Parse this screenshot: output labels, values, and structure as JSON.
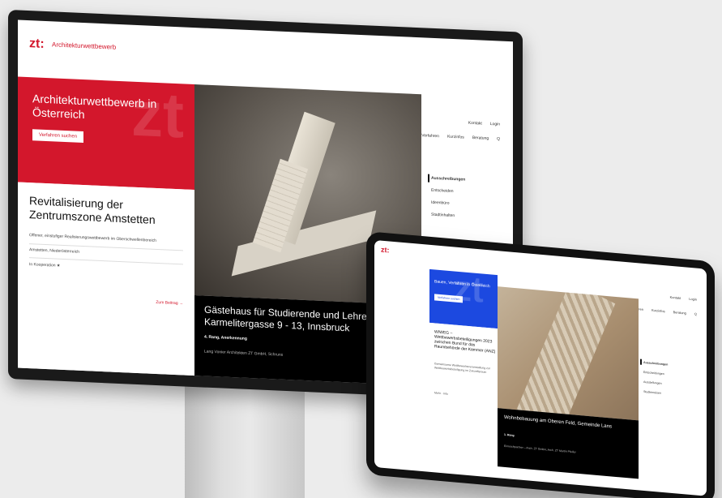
{
  "desktop": {
    "logo": "zt:",
    "logo_sub": "Architekturwettbewerb",
    "util_nav": [
      "Kontakt",
      "Login"
    ],
    "main_nav": [
      "Verfahren",
      "Kurzinfos",
      "Beratung",
      "Q"
    ],
    "hero_watermark": "zt",
    "hero_title": "Architekturwettbewerb in Österreich",
    "hero_button": "Verfahren suchen",
    "info_title": "Revitalisierung der Zentrumszone Amstetten",
    "info_line1": "Offener, einstufiger Realisierungswettbewerb im Oberschwellenbereich",
    "info_line2": "Amstetten, Niederösterreich",
    "info_line3": "In Kooperation ★",
    "info_link": "Zum Beitrag →",
    "caption_title": "Gästehaus für Studierende und Lehrende Karmelitergasse 9 - 13, Innsbruck",
    "caption_subtitle": "4. Rang, Anerkennung",
    "caption_meta": "Lang Vonier Architekten ZT GmbH, Schruns",
    "side_items": [
      "Ausschreibungen",
      "Entscheiden",
      "Ideenbüro",
      "Stadtinhalten"
    ]
  },
  "tablet": {
    "logo": "zt:",
    "util_nav": [
      "Kontakt",
      "Login"
    ],
    "main_nav": [
      "Verfahren",
      "Kurzinfos",
      "Beratung",
      "Q"
    ],
    "hero_watermark": "zt",
    "hero_title": "Bauen, Verfahren in Österreich",
    "hero_button": "Verfahren suchen",
    "info_title": "WIWEG – Wettbewerbsbeteiligungen 2023 zwischen Bund für das Raumbehörde der Kammer (ANZ)",
    "info_sub": "Gemeinsame Wettbewerbsveranstaltung zur Wettbewerbsbeteiligung im Zukunftsraum",
    "info_foot": "Mehr · Info",
    "caption_title": "Wohnbebauung am Oberen Feld, Gemeinde Lans",
    "caption_subtitle": "1. Rang",
    "caption_meta": "Einreichpartner – Arch. ZT GmbH, Arch. ZT Martin Pfeifer",
    "side_items": [
      "Ausschreibungen",
      "Entscheidungen",
      "Ausstellungen",
      "Studienreisen"
    ]
  }
}
